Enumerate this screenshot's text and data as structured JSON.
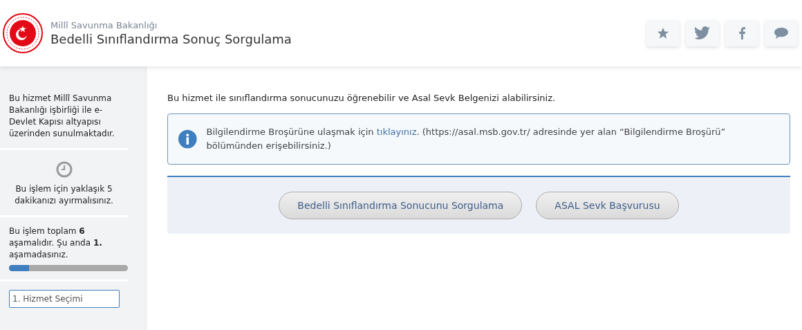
{
  "header": {
    "org": "Millî Savunma Bakanlığı",
    "title": "Bedelli Sınıflandırma Sonuç Sorgulama",
    "actions": [
      {
        "kind": "star"
      },
      {
        "kind": "twitter"
      },
      {
        "kind": "facebook"
      },
      {
        "kind": "comment"
      }
    ]
  },
  "sidebar": {
    "about": "Bu hizmet Millî Savunma Bakanlığı işbirliği ile e-Devlet Kapısı altyapısı üzerinden sunulmaktadır.",
    "duration": "Bu işlem için yaklaşık 5 dakikanızı ayırmalısınız.",
    "progress_text": "Bu işlem toplam **6** aşamalıdır. Şu anda **1.** aşamadasınız.",
    "progress": {
      "level": 0.17
    },
    "steps": [
      {
        "label": "1. Hizmet Seçimi",
        "selected": true
      }
    ]
  },
  "main": {
    "intro": "Bu hizmet ile sınıflandırma sonucunuzu öğrenebilir ve Asal Sevk Belgenizi alabilirsiniz.",
    "info": {
      "before": "Bilgilendirme Broşürüne ulaşmak için",
      "link": "tıklayınız",
      "after": ". (https://asal.msb.gov.tr/ adresinde yer alan “Bilgilendirme Broşürü” bölümünden erişebilirsiniz.)"
    },
    "buttons": [
      "Bedelli Sınıflandırma Sonucunu Sorgulama",
      "ASAL Sevk Başvurusu"
    ]
  }
}
